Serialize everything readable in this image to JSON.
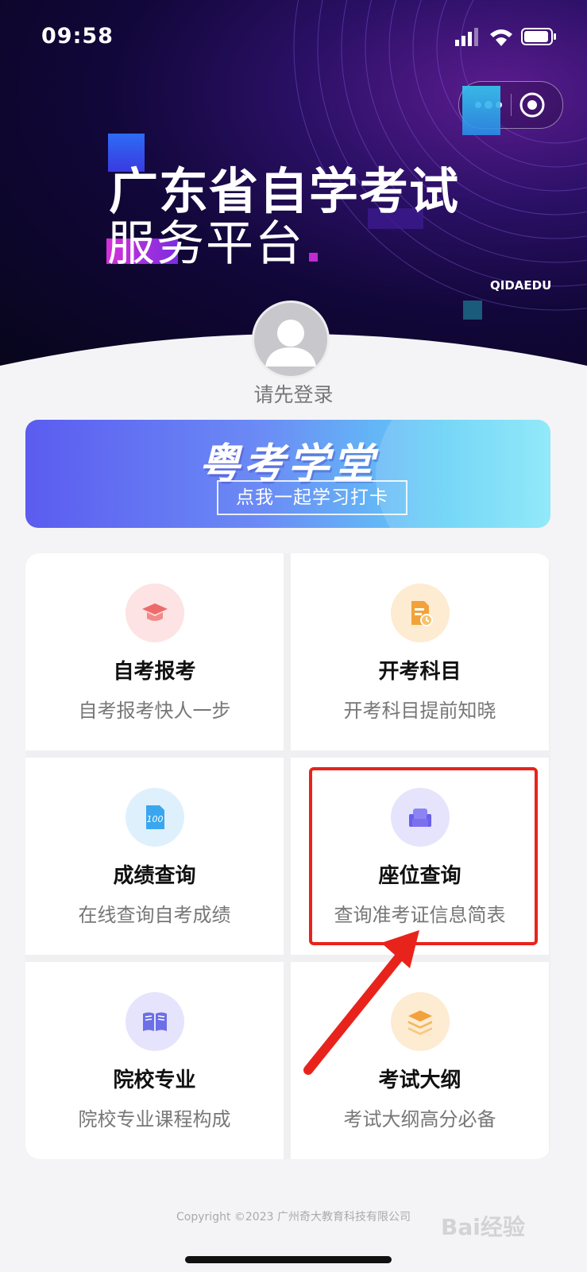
{
  "status_bar": {
    "time": "09:58"
  },
  "header": {
    "title_line1": "广东省自学考试",
    "title_line2": "服务平台",
    "brand": "QIDAEDU"
  },
  "user": {
    "login_prompt": "请先登录"
  },
  "banner": {
    "title": "粤考学堂",
    "button_label": "点我一起学习打卡"
  },
  "menu": [
    {
      "name": "自考报考",
      "desc": "自考报考快人一步",
      "icon": "graduation-cap-icon",
      "color": "#ef6b6b"
    },
    {
      "name": "开考科目",
      "desc": "开考科目提前知晓",
      "icon": "document-clock-icon",
      "color": "#f2a23a"
    },
    {
      "name": "成绩查询",
      "desc": "在线查询自考成绩",
      "icon": "score-sheet-icon",
      "color": "#3aa6ef"
    },
    {
      "name": "座位查询",
      "desc": "查询准考证信息简表",
      "icon": "seat-icon",
      "color": "#7b6ff0"
    },
    {
      "name": "院校专业",
      "desc": "院校专业课程构成",
      "icon": "open-book-icon",
      "color": "#6c6fe8"
    },
    {
      "name": "考试大纲",
      "desc": "考试大纲高分必备",
      "icon": "layers-icon",
      "color": "#f2a23a"
    }
  ],
  "footer": {
    "copyright": "Copyright ©2023 广州奇大教育科技有限公司"
  },
  "watermark": {
    "text": "Bai经验"
  }
}
